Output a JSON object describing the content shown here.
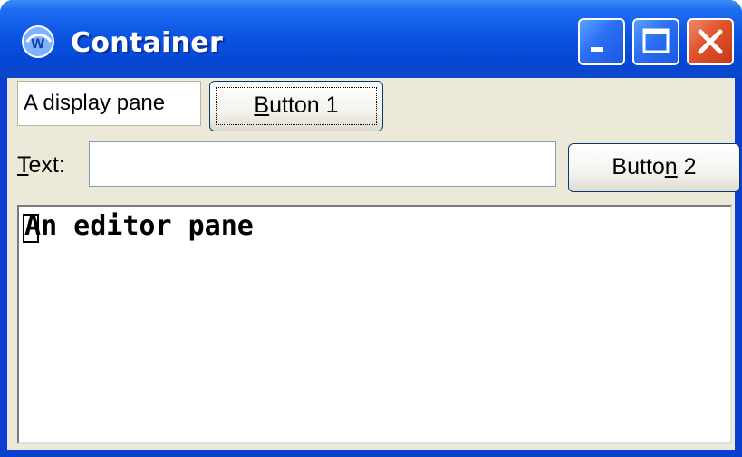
{
  "window": {
    "title": "Container"
  },
  "display_pane": {
    "text": "A display pane"
  },
  "buttons": {
    "button1": {
      "accel": "B",
      "rest": "utton 1"
    },
    "button2": {
      "before": "Butto",
      "accel": "n",
      "after": " 2"
    }
  },
  "text_field": {
    "label_accel": "T",
    "label_rest": "ext:",
    "value": ""
  },
  "editor": {
    "first_char": "A",
    "rest": "n editor pane"
  },
  "colors": {
    "titlebar": "#0b55e3",
    "client": "#ece9d8",
    "close": "#e0522c"
  },
  "icons": [
    "app-icon",
    "minimize-icon",
    "maximize-icon",
    "close-icon"
  ]
}
